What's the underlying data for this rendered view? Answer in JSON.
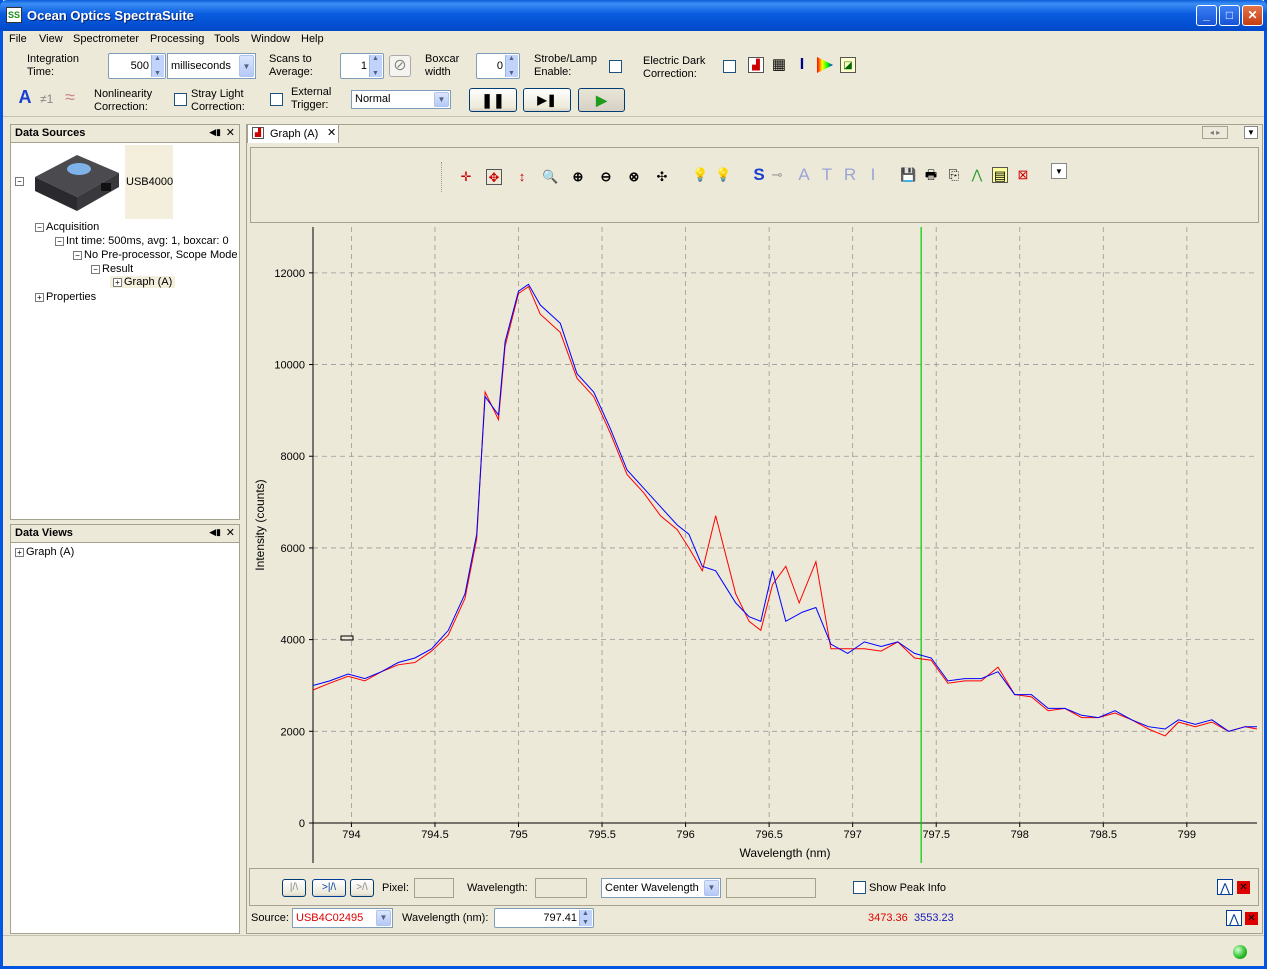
{
  "window": {
    "title": "Ocean Optics SpectraSuite"
  },
  "menu": [
    "File",
    "View",
    "Spectrometer",
    "Processing",
    "Tools",
    "Window",
    "Help"
  ],
  "toolbar": {
    "integration_label_1": "Integration",
    "integration_label_2": "Time:",
    "integration_value": "500",
    "integration_units": "milliseconds",
    "scans_label_1": "Scans to",
    "scans_label_2": "Average:",
    "scans_value": "1",
    "boxcar_label_1": "Boxcar",
    "boxcar_label_2": "width",
    "boxcar_value": "0",
    "strobe_label_1": "Strobe/Lamp",
    "strobe_label_2": "Enable:",
    "dark_label_1": "Electric Dark",
    "dark_label_2": "Correction:",
    "nonlin_label_1": "Nonlinearity",
    "nonlin_label_2": "Correction:",
    "stray_label_1": "Stray Light",
    "stray_label_2": "Correction:",
    "trigger_label_1": "External",
    "trigger_label_2": "Trigger:",
    "trigger_value": "Normal",
    "ne1_label": "≠1"
  },
  "data_sources": {
    "title": "Data Sources",
    "device": "USB4000",
    "acquisition": "Acquisition",
    "int_time": "Int time: 500ms, avg: 1, boxcar: 0",
    "preproc": "No Pre-processor, Scope Mode",
    "result": "Result",
    "graph": "Graph (A)",
    "properties": "Properties"
  },
  "data_views": {
    "title": "Data Views",
    "graph": "Graph (A)"
  },
  "graph_tab": {
    "label": "Graph (A)"
  },
  "graph_toolbar": {
    "letters": [
      "S",
      "A",
      "T",
      "R",
      "I"
    ]
  },
  "chart_data": {
    "type": "line",
    "xlabel": "Wavelength (nm)",
    "ylabel": "Intensity (counts)",
    "xlim": [
      793.77,
      799.42
    ],
    "ylim": [
      0,
      13000
    ],
    "xticks": [
      794,
      794.5,
      795,
      795.5,
      796,
      796.5,
      797,
      797.5,
      798,
      798.5,
      799
    ],
    "xtick_labels": [
      "794",
      "794.5",
      "795",
      "795.5",
      "796",
      "796.5",
      "797",
      "797.5",
      "798",
      "798.5",
      "799"
    ],
    "yticks": [
      0,
      2000,
      4000,
      6000,
      8000,
      10000,
      12000
    ],
    "ytick_labels": [
      "0",
      "2000",
      "4000",
      "6000",
      "8000",
      "10000",
      "12000"
    ],
    "grid": true,
    "cursor_x": 797.41,
    "series": [
      {
        "color": "#0000ff",
        "x": [
          793.77,
          793.87,
          793.98,
          794.08,
          794.18,
          794.28,
          794.38,
          794.48,
          794.58,
          794.68,
          794.75,
          794.8,
          794.88,
          794.92,
          795.0,
          795.06,
          795.13,
          795.25,
          795.35,
          795.45,
          795.55,
          795.65,
          795.75,
          795.85,
          795.95,
          796.02,
          796.1,
          796.18,
          796.3,
          796.38,
          796.45,
          796.52,
          796.6,
          796.7,
          796.78,
          796.87,
          796.97,
          797.07,
          797.17,
          797.27,
          797.37,
          797.47,
          797.57,
          797.67,
          797.77,
          797.87,
          797.97,
          798.07,
          798.17,
          798.27,
          798.37,
          798.47,
          798.57,
          798.67,
          798.77,
          798.87,
          798.95,
          799.05,
          799.15,
          799.25,
          799.35,
          799.42
        ],
        "values": [
          3000,
          3100,
          3250,
          3150,
          3300,
          3500,
          3600,
          3800,
          4200,
          5000,
          6300,
          9300,
          8900,
          10500,
          11600,
          11750,
          11300,
          10900,
          9800,
          9400,
          8600,
          7700,
          7300,
          6900,
          6500,
          6300,
          5600,
          5500,
          4800,
          4500,
          4400,
          5500,
          4400,
          4600,
          4700,
          3900,
          3700,
          3950,
          3850,
          3950,
          3700,
          3600,
          3100,
          3150,
          3150,
          3300,
          2800,
          2800,
          2500,
          2500,
          2350,
          2300,
          2450,
          2250,
          2100,
          2050,
          2250,
          2150,
          2250,
          2000,
          2100,
          2100
        ]
      },
      {
        "color": "#ff0000",
        "x": [
          793.77,
          793.87,
          793.98,
          794.08,
          794.18,
          794.28,
          794.38,
          794.48,
          794.58,
          794.68,
          794.75,
          794.8,
          794.88,
          794.92,
          795.0,
          795.06,
          795.13,
          795.25,
          795.35,
          795.45,
          795.55,
          795.65,
          795.75,
          795.85,
          795.95,
          796.02,
          796.1,
          796.18,
          796.3,
          796.38,
          796.45,
          796.52,
          796.6,
          796.68,
          796.78,
          796.87,
          796.97,
          797.07,
          797.17,
          797.27,
          797.37,
          797.47,
          797.57,
          797.67,
          797.77,
          797.87,
          797.97,
          798.07,
          798.17,
          798.27,
          798.37,
          798.47,
          798.57,
          798.67,
          798.77,
          798.87,
          798.95,
          799.05,
          799.15,
          799.25,
          799.35,
          799.42
        ],
        "values": [
          2900,
          3050,
          3200,
          3100,
          3300,
          3450,
          3500,
          3750,
          4100,
          4900,
          6200,
          9400,
          8800,
          10400,
          11550,
          11700,
          11100,
          10700,
          9700,
          9300,
          8500,
          7600,
          7200,
          6700,
          6400,
          6000,
          5500,
          6700,
          5000,
          4400,
          4200,
          5200,
          5600,
          4800,
          5700,
          3800,
          3800,
          3800,
          3750,
          3950,
          3600,
          3550,
          3050,
          3100,
          3100,
          3400,
          2800,
          2750,
          2450,
          2500,
          2300,
          2300,
          2400,
          2250,
          2050,
          1900,
          2200,
          2100,
          2200,
          2000,
          2100,
          2050
        ]
      }
    ]
  },
  "peak_bar": {
    "pixel_label": "Pixel:",
    "wavelength_label": "Wavelength:",
    "center_wavelength": "Center Wavelength",
    "show_peak_info": "Show Peak Info"
  },
  "source_bar": {
    "source_label": "Source:",
    "source_value": "USB4C02495",
    "wavelength_label": "Wavelength (nm):",
    "wavelength_value": "797.41",
    "red_value": "3473.36",
    "blue_value": "3553.23",
    "red_color": "#ff0000",
    "blue_color": "#0000ff"
  },
  "colors": {
    "title_blue": "#0a5ce0",
    "cursor_green": "#00cc00",
    "grid": "#999999"
  }
}
